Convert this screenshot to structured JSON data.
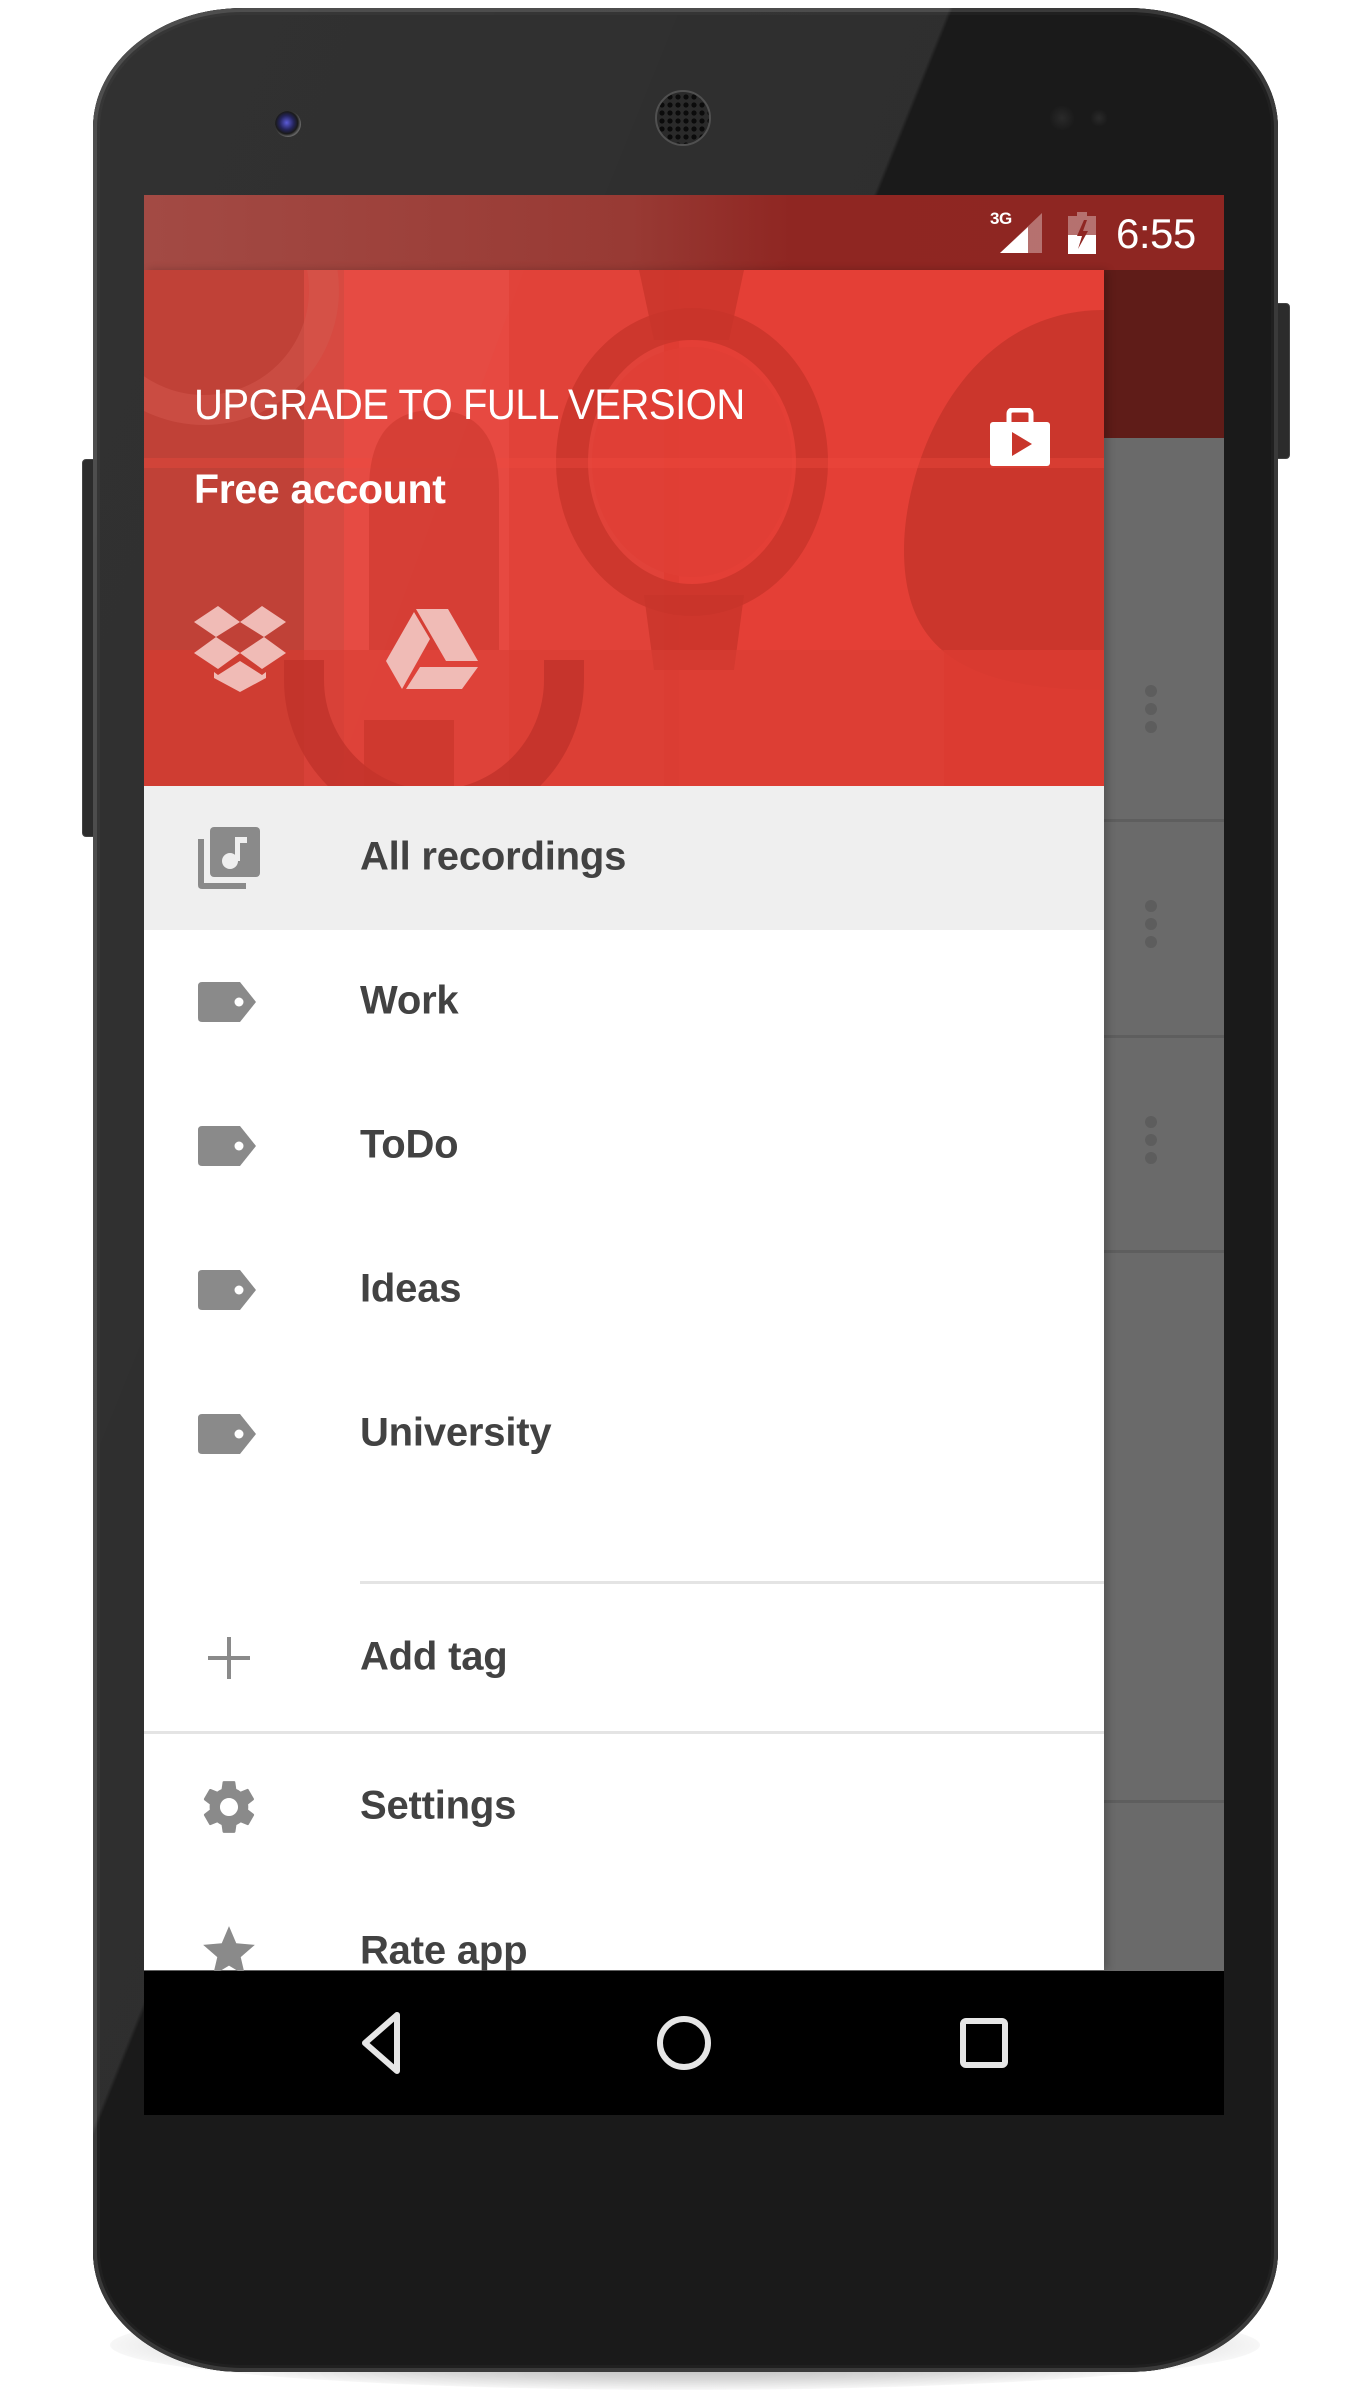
{
  "device": {
    "model": "phone"
  },
  "status_bar": {
    "network": "3G",
    "time": "6:55",
    "signal_icon": "signal-icon",
    "battery_icon": "battery-charging-icon"
  },
  "drawer": {
    "header": {
      "upgrade_label": "UPGRADE TO FULL VERSION",
      "account_label": "Free account",
      "store_icon": "play-store-icon",
      "cloud_services": [
        {
          "name": "Dropbox",
          "icon": "dropbox-icon"
        },
        {
          "name": "Google Drive",
          "icon": "google-drive-icon"
        }
      ]
    },
    "items": [
      {
        "label": "All recordings",
        "icon": "library-music-icon",
        "active": true
      },
      {
        "label": "Work",
        "icon": "tag-icon",
        "active": false
      },
      {
        "label": "ToDo",
        "icon": "tag-icon",
        "active": false
      },
      {
        "label": "Ideas",
        "icon": "tag-icon",
        "active": false
      },
      {
        "label": "University",
        "icon": "tag-icon",
        "active": false
      }
    ],
    "add_tag": {
      "label": "Add tag",
      "icon": "plus-icon"
    },
    "footer_items": [
      {
        "label": "Settings",
        "icon": "gear-icon"
      },
      {
        "label": "Rate app",
        "icon": "star-icon"
      }
    ]
  },
  "background_list": {
    "row_action_icon": "more-vert-icon"
  },
  "nav_bar": {
    "back_icon": "back-icon",
    "home_icon": "home-icon",
    "recents_icon": "recents-icon"
  },
  "colors": {
    "accent": "#e2433a",
    "status_bar": "#8f2622",
    "app_bar_dimmed": "#5f1c18",
    "text_primary": "#424242",
    "icon_gray": "#8a8a8a",
    "active_row": "#efefef"
  }
}
